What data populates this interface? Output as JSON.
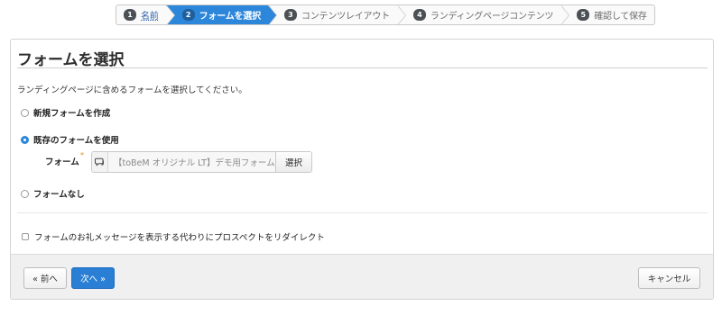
{
  "wizard": {
    "steps": [
      {
        "num": "1",
        "label": "名前",
        "state": "done"
      },
      {
        "num": "2",
        "label": "フォームを選択",
        "state": "active"
      },
      {
        "num": "3",
        "label": "コンテンツレイアウト",
        "state": "pending"
      },
      {
        "num": "4",
        "label": "ランディングページコンテンツ",
        "state": "pending"
      },
      {
        "num": "5",
        "label": "確認して保存",
        "state": "pending"
      }
    ]
  },
  "panel": {
    "title": "フォームを選択",
    "instructions": "ランディングページに含めるフォームを選択してください。"
  },
  "options": {
    "new_form": {
      "label": "新規フォームを作成",
      "checked": false
    },
    "existing_form": {
      "label": "既存のフォームを使用",
      "checked": true
    },
    "no_form": {
      "label": "フォームなし",
      "checked": false
    }
  },
  "form_picker": {
    "label": "フォーム",
    "required_mark": "*",
    "icon": "comment-bubble-icon",
    "value": "【toBeM オリジナル LT】デモ用フォーム カ",
    "select_label": "選択"
  },
  "redirect": {
    "label": "フォームのお礼メッセージを表示する代わりにプロスペクトをリダイレクト",
    "checked": false
  },
  "footer": {
    "prev_label": "« 前へ",
    "next_label": "次へ »",
    "cancel_label": "キャンセル"
  },
  "colors": {
    "accent": "#2c86d9",
    "primary_button": "#2a7fd4",
    "required": "#e08a00"
  }
}
